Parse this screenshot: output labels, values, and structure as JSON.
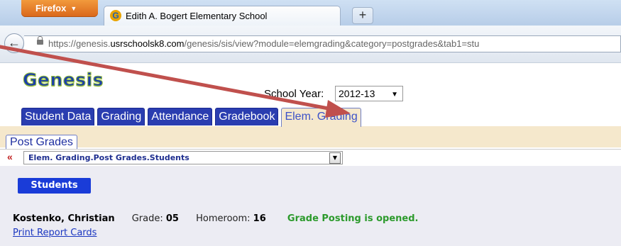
{
  "browser": {
    "menu_label": "Firefox",
    "tab_title": "Edith A. Bogert Elementary School",
    "new_tab_symbol": "+",
    "favicon_letter": "G",
    "url_prefix": "https://genesis.",
    "url_domain": "usrschoolsk8.com",
    "url_path": "/genesis/sis/view?module=elemgrading&category=postgrades&tab1=stu"
  },
  "header": {
    "logo": "Genesis",
    "school_year_label": "School Year:",
    "school_year_value": "2012-13"
  },
  "main_tabs": [
    {
      "label": "Student Data"
    },
    {
      "label": "Grading"
    },
    {
      "label": "Attendance"
    },
    {
      "label": "Gradebook"
    },
    {
      "label": "Elem. Grading"
    }
  ],
  "sub_tab": "Post Grades",
  "breadcrumb": {
    "arrow": "«",
    "value": "Elem. Grading.Post Grades.Students"
  },
  "students_button": "Students",
  "student": {
    "name": "Kostenko, Christian",
    "grade_label": "Grade:",
    "grade_value": "05",
    "homeroom_label": "Homeroom:",
    "homeroom_value": "16",
    "status": "Grade Posting is opened."
  },
  "print_link": "Print Report Cards",
  "colors": {
    "tab_blue": "#2a3db0",
    "status_green": "#2c9a2c",
    "annotation_arrow": "#c0504d"
  }
}
